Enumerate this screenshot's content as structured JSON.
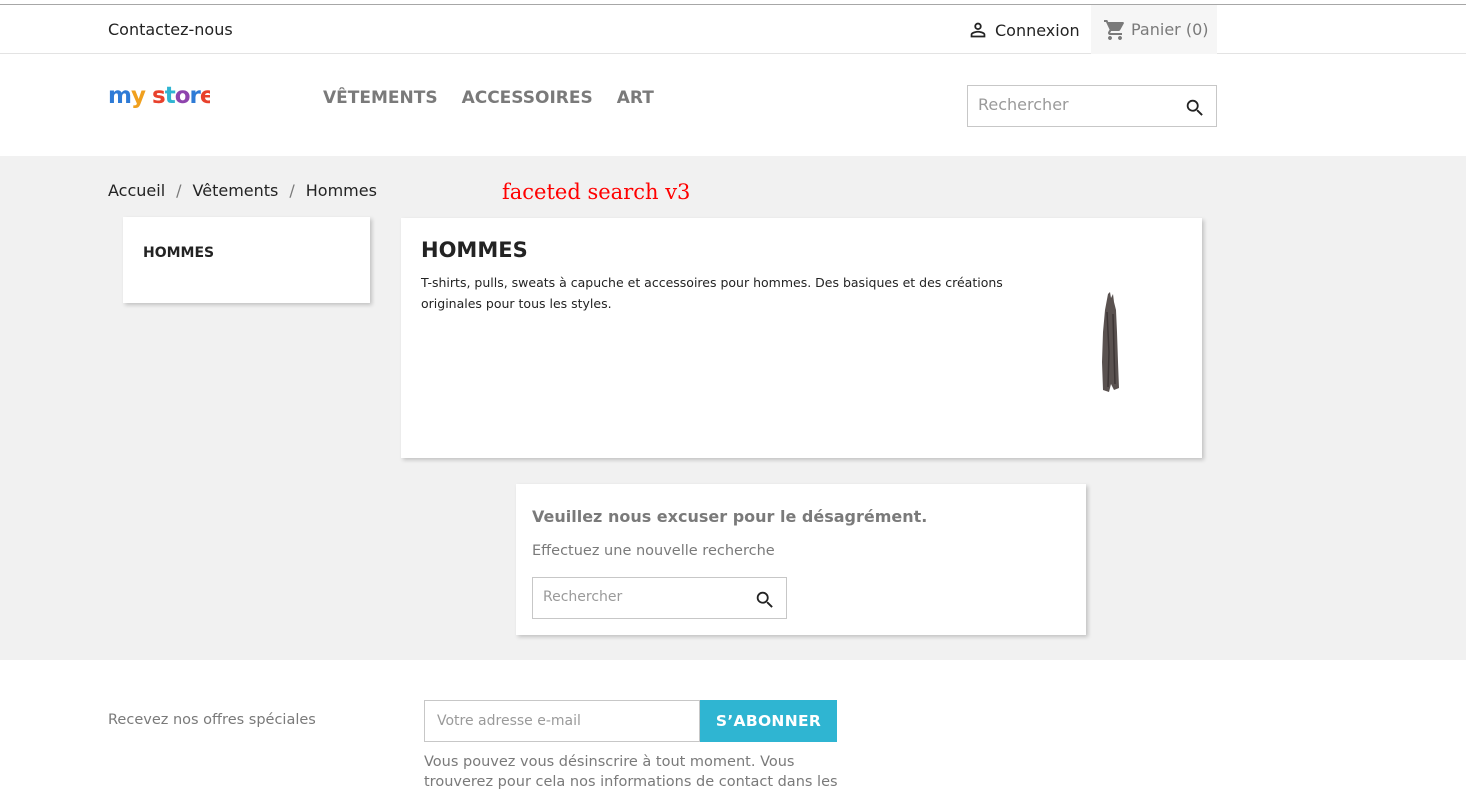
{
  "nav": {
    "contact_label": "Contactez-nous",
    "login_label": "Connexion",
    "cart_label": "Panier (0)"
  },
  "header": {
    "logo_text": "my store",
    "menu": [
      {
        "label": "VÊTEMENTS"
      },
      {
        "label": "ACCESSOIRES"
      },
      {
        "label": "ART"
      }
    ],
    "search_placeholder": "Rechercher"
  },
  "breadcrumb": {
    "items": [
      {
        "label": "Accueil"
      },
      {
        "label": "Vêtements"
      },
      {
        "label": "Hommes"
      }
    ],
    "separator": "/"
  },
  "annotation": "faceted search v3",
  "sidebar": {
    "title": "HOMMES"
  },
  "category": {
    "title": "HOMMES",
    "description": "T-shirts, pulls, sweats à capuche et accessoires pour hommes. Des basiques et des créations originales pour tous les styles."
  },
  "no_results": {
    "title": "Veuillez nous excuser pour le désagrément.",
    "subtitle": "Effectuez une nouvelle recherche",
    "search_placeholder": "Rechercher"
  },
  "footer": {
    "offers_label": "Recevez nos offres spéciales",
    "email_placeholder": "Votre adresse e-mail",
    "subscribe_label": "S’ABONNER",
    "unsubscribe_text": "Vous pouvez vous désinscrire à tout moment. Vous trouverez pour cela nos informations de contact dans les"
  },
  "colors": {
    "accent": "#2fb5d2",
    "annotation": "#ff0000",
    "background": "#f1f1f1"
  },
  "icons": {
    "user": "user-icon",
    "cart": "shopping-cart-icon",
    "search": "search-icon"
  }
}
